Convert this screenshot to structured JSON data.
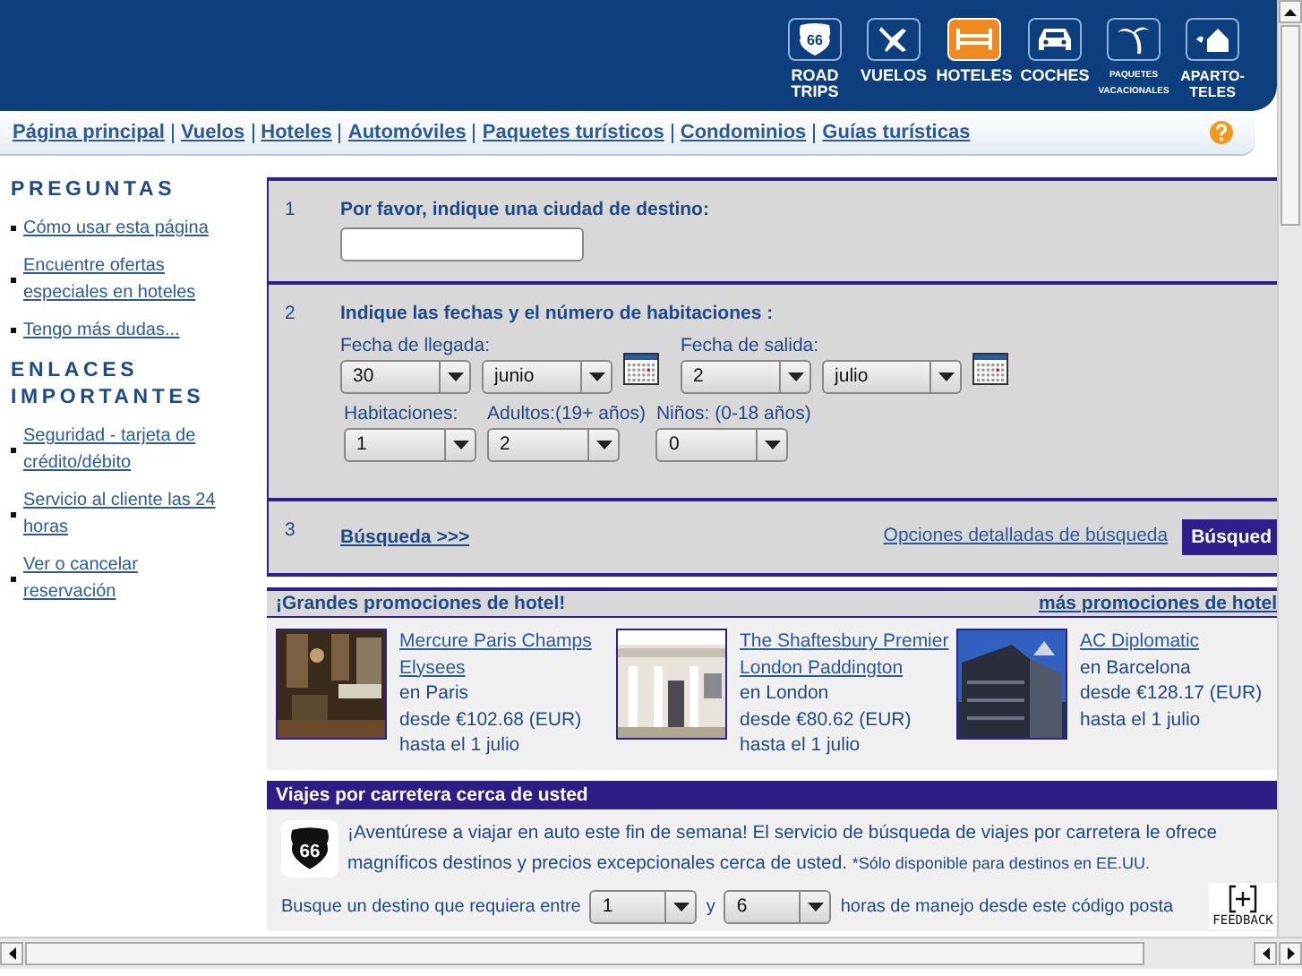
{
  "header": {
    "tabs": [
      {
        "kind": "shield",
        "label": "ROAD TRIPS",
        "icon_text": "66",
        "selected": false
      },
      {
        "kind": "plane",
        "label": "VUELOS",
        "selected": false
      },
      {
        "kind": "bed",
        "label": "HOTELES",
        "selected": true
      },
      {
        "kind": "car",
        "label": "COCHES",
        "selected": false
      },
      {
        "kind": "palm",
        "label": "PAQUETES VACACIONALES",
        "selected": false
      },
      {
        "kind": "house",
        "label": "APARTO-TELES",
        "selected": false
      }
    ]
  },
  "nav": {
    "links": [
      "Página principal",
      "Vuelos",
      "Hoteles",
      "Automóviles",
      "Paquetes turísticos",
      "Condominios",
      "Guías turísticas"
    ]
  },
  "sidebar": {
    "sections": [
      {
        "title": "PREGUNTAS",
        "links": [
          "Cómo usar esta página",
          "Encuentre ofertas especiales en hoteles",
          "Tengo más dudas..."
        ]
      },
      {
        "title": "ENLACES IMPORTANTES",
        "links": [
          "Seguridad - tarjeta de crédito/débito",
          "Servicio al cliente las 24 horas",
          "Ver o cancelar reservación"
        ]
      }
    ]
  },
  "search_form": {
    "step1": {
      "number": "1",
      "label": "Por favor, indique una ciudad de destino:"
    },
    "step2": {
      "number": "2",
      "title": "Indique las fechas y el número de habitaciones :",
      "arrival_label": "Fecha de llegada:",
      "arrival_day": "30",
      "arrival_month": "junio",
      "departure_label": "Fecha de salida:",
      "departure_day": "2",
      "departure_month": "julio",
      "rooms_label": "Habitaciones:",
      "rooms": "1",
      "adults_label": "Adultos:(19+ años)",
      "adults": "2",
      "children_label": "Niños: (0-18 años)",
      "children": "0"
    },
    "step3": {
      "number": "3",
      "search_link": "Búsqueda >>>",
      "options_link": "Opciones detalladas de búsqueda",
      "button": "Búsqued"
    }
  },
  "promotions": {
    "title": "¡Grandes promociones de hotel!",
    "more_link": "más promociones de hotel",
    "hotels": [
      {
        "name": "Mercure Paris Champs Elysees",
        "city": "en Paris",
        "price": "desde €102.68 (EUR)",
        "until": "hasta el 1 julio",
        "kind": "picture"
      },
      {
        "name": "The Shaftesbury Premier London Paddington",
        "city": "en London",
        "price": "desde €80.62 (EUR)",
        "until": "hasta el 1 julio",
        "kind": "picture"
      },
      {
        "name": "AC Diplomatic",
        "city": "en Barcelona",
        "price": "desde €128.17 (EUR)",
        "until": "hasta el 1 julio",
        "kind": "picture"
      }
    ]
  },
  "road_trips": {
    "title": "Viajes por carretera cerca de usted",
    "icon_text": "66",
    "intro": "¡Aventúrese a viajar en auto este fin de semana! El servicio de búsqueda de viajes por carretera le ofrece magníficos destinos y precios excepcionales cerca de usted.",
    "note": "*Sólo disponible para destinos en EE.UU.",
    "prompt": "Busque un destino que requiera entre",
    "min_hours": "1",
    "conjunction": "y",
    "max_hours": "6",
    "suffix": "horas de manejo desde este código posta"
  },
  "feedback": {
    "label": "FEEDBACK"
  }
}
